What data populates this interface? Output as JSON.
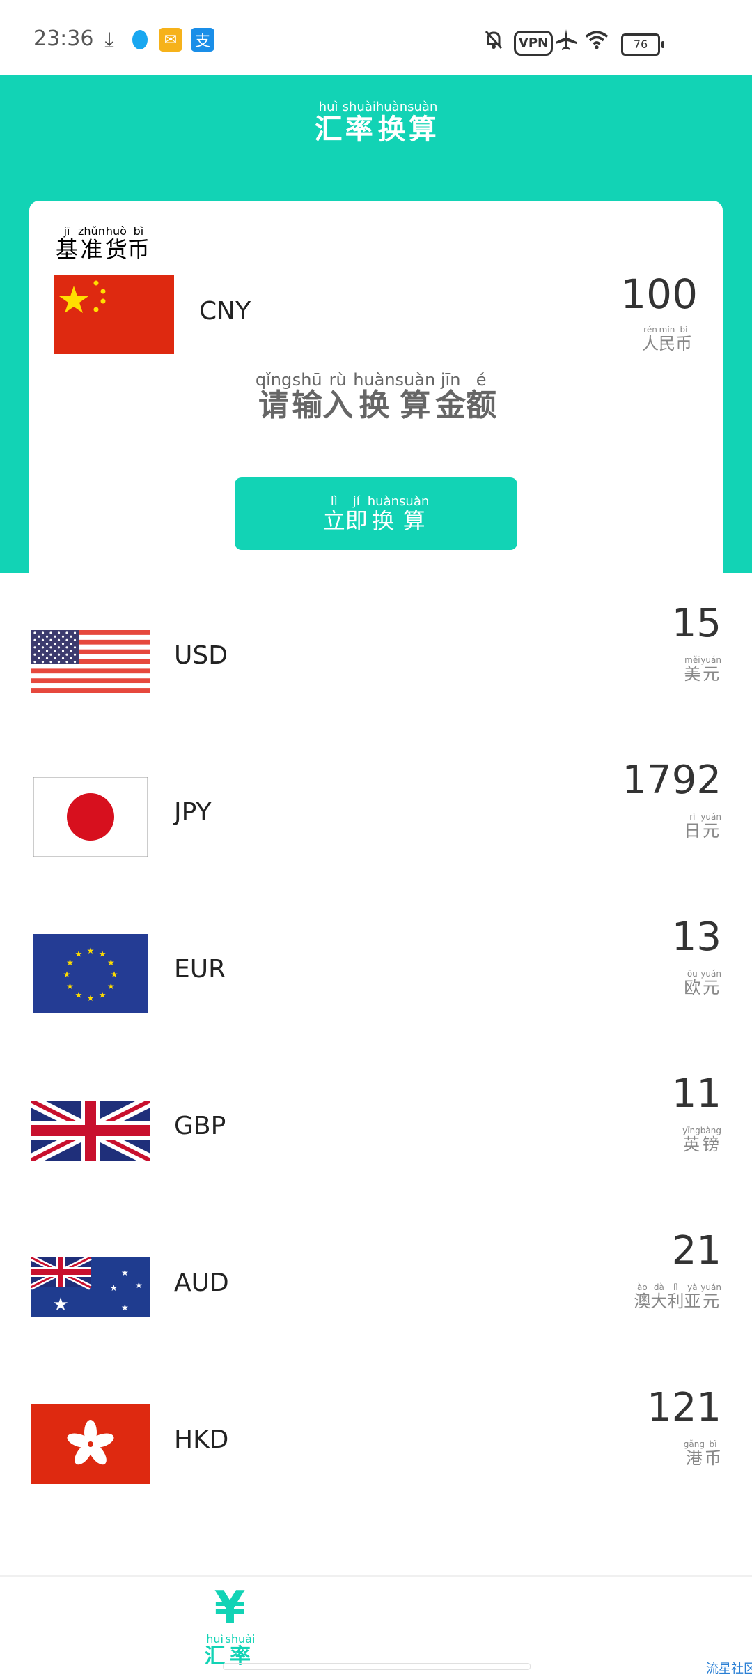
{
  "status_bar": {
    "time": "23:36",
    "vpn": "VPN",
    "battery": "76"
  },
  "header": {
    "title": [
      {
        "py": "huì",
        "hz": "汇"
      },
      {
        "py": "shuài",
        "hz": "率"
      },
      {
        "py": "huàn",
        "hz": "换"
      },
      {
        "py": "suàn",
        "hz": "算"
      }
    ]
  },
  "base": {
    "label": [
      {
        "py": "jī",
        "hz": "基"
      },
      {
        "py": "zhǔn",
        "hz": "准"
      },
      {
        "py": "huò",
        "hz": "货"
      },
      {
        "py": "bì",
        "hz": "币"
      }
    ],
    "code": "CNY",
    "amount": "100",
    "name": [
      {
        "py": "rén",
        "hz": "人"
      },
      {
        "py": "mín",
        "hz": "民"
      },
      {
        "py": "bì",
        "hz": "币"
      }
    ]
  },
  "input_hint": [
    {
      "py": "qǐng",
      "hz": "请"
    },
    {
      "py": "shū",
      "hz": "输"
    },
    {
      "py": "rù",
      "hz": "入"
    },
    {
      "py": "huàn",
      "hz": "换"
    },
    {
      "py": "suàn",
      "hz": "算"
    },
    {
      "py": "jīn",
      "hz": "金"
    },
    {
      "py": "é",
      "hz": "额"
    }
  ],
  "convert_button": [
    {
      "py": "lì",
      "hz": "立"
    },
    {
      "py": "jí",
      "hz": "即"
    },
    {
      "py": "huàn",
      "hz": "换"
    },
    {
      "py": "suàn",
      "hz": "算"
    }
  ],
  "currencies": [
    {
      "code": "USD",
      "amount": "15",
      "flag": "us-flag",
      "name": [
        {
          "py": "měi",
          "hz": "美"
        },
        {
          "py": "yuán",
          "hz": "元"
        }
      ]
    },
    {
      "code": "JPY",
      "amount": "1792",
      "flag": "jp-flag",
      "name": [
        {
          "py": "rì",
          "hz": "日"
        },
        {
          "py": "yuán",
          "hz": "元"
        }
      ]
    },
    {
      "code": "EUR",
      "amount": "13",
      "flag": "eu-flag",
      "name": [
        {
          "py": "ōu",
          "hz": "欧"
        },
        {
          "py": "yuán",
          "hz": "元"
        }
      ]
    },
    {
      "code": "GBP",
      "amount": "11",
      "flag": "gb-flag",
      "name": [
        {
          "py": "yīng",
          "hz": "英"
        },
        {
          "py": "bàng",
          "hz": "镑"
        }
      ]
    },
    {
      "code": "AUD",
      "amount": "21",
      "flag": "au-flag",
      "name": [
        {
          "py": "ào",
          "hz": "澳"
        },
        {
          "py": "dà",
          "hz": "大"
        },
        {
          "py": "lì",
          "hz": "利"
        },
        {
          "py": "yà",
          "hz": "亚"
        },
        {
          "py": "yuán",
          "hz": "元"
        }
      ]
    },
    {
      "code": "HKD",
      "amount": "121",
      "flag": "hk-flag",
      "name": [
        {
          "py": "gǎng",
          "hz": "港"
        },
        {
          "py": "bì",
          "hz": "币"
        }
      ]
    }
  ],
  "bottom_nav": {
    "icon": "¥",
    "label": [
      {
        "py": "huì",
        "hz": "汇"
      },
      {
        "py": "shuài",
        "hz": "率"
      }
    ]
  },
  "watermark": "流星社区",
  "colors": {
    "accent": "#12d3b5",
    "text": "#222222",
    "muted": "#888888"
  }
}
